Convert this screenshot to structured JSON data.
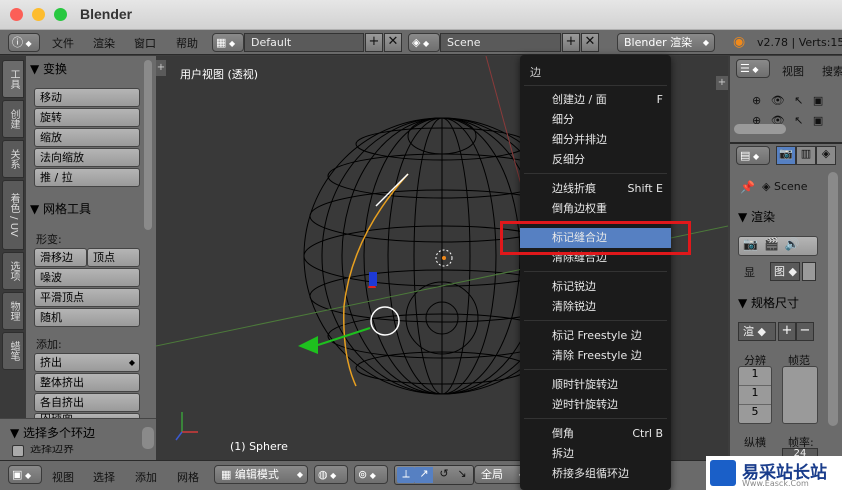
{
  "window": {
    "title": "Blender"
  },
  "top_header": {
    "menus": [
      "文件",
      "渲染",
      "窗口",
      "帮助"
    ],
    "layout_field": "Default",
    "scene_field": "Scene",
    "engine": "Blender 渲染",
    "version": "v2.78 | Verts:15"
  },
  "tabs": [
    "工具",
    "创建",
    "关系",
    "着色 / UV",
    "选项",
    "物理",
    "蜡笔"
  ],
  "tool_shelf": {
    "transform": {
      "header": "▼ 变换",
      "buttons": [
        "移动",
        "旋转",
        "缩放",
        "法向缩放",
        "推 / 拉"
      ]
    },
    "mesh_tools": {
      "header": "▼ 网格工具",
      "deform_label": "形变:",
      "slide_edge": "滑移边",
      "vertex": "顶点",
      "buttons": [
        "噪波",
        "平滑顶点",
        "随机"
      ],
      "add_label": "添加:",
      "extrude": "挤出",
      "add_buttons": [
        "整体挤出",
        "各自挤出",
        "内插面"
      ]
    },
    "select_loops": {
      "header": "▼ 选择多个环边",
      "checkbox": "选择边界"
    }
  },
  "viewport": {
    "label": "用户视图 (透视)",
    "object": "(1) Sphere"
  },
  "outliner": {
    "view": "视图",
    "search": "搜索"
  },
  "properties": {
    "scene": "Scene",
    "render_header": "▼ 渲染",
    "display_label": "显",
    "dimensions_header": "▼ 规格尺寸",
    "render_preset": "渲",
    "resolution_label": "分辨",
    "frame_range_label": "帧范",
    "res_values": [
      "1",
      "1",
      "5"
    ],
    "aspect_label": "纵横",
    "fps_label": "帧率:",
    "fps_value": "24"
  },
  "menu": {
    "title": "边",
    "items": [
      {
        "label": "创建边 / 面",
        "shortcut": "F"
      },
      {
        "label": "细分",
        "shortcut": ""
      },
      {
        "label": "细分并排边",
        "shortcut": ""
      },
      {
        "label": "反细分",
        "shortcut": ""
      },
      {
        "label": "边线折痕",
        "shortcut": "Shift E"
      },
      {
        "label": "倒角边权重",
        "shortcut": ""
      },
      {
        "label": "标记缝合边",
        "shortcut": ""
      },
      {
        "label": "清除缝合边",
        "shortcut": ""
      },
      {
        "label": "标记锐边",
        "shortcut": ""
      },
      {
        "label": "清除锐边",
        "shortcut": ""
      },
      {
        "label": "标记 Freestyle 边",
        "shortcut": ""
      },
      {
        "label": "清除 Freestyle 边",
        "shortcut": ""
      },
      {
        "label": "顺时针旋转边",
        "shortcut": ""
      },
      {
        "label": "逆时针旋转边",
        "shortcut": ""
      },
      {
        "label": "倒角",
        "shortcut": "Ctrl B"
      },
      {
        "label": "拆边",
        "shortcut": ""
      },
      {
        "label": "桥接多组循环边",
        "shortcut": ""
      }
    ]
  },
  "bottom_header": {
    "menus": [
      "视图",
      "选择",
      "添加",
      "网格"
    ],
    "mode": "编辑模式",
    "orientation": "全局"
  },
  "watermark": {
    "text": "易采站长站",
    "sub": "Www.Easck.Com"
  },
  "colors": {
    "highlight": "#5680c2",
    "redbox": "#e0181b",
    "sphere_wire": "#000000",
    "seam": "#e8a020"
  }
}
